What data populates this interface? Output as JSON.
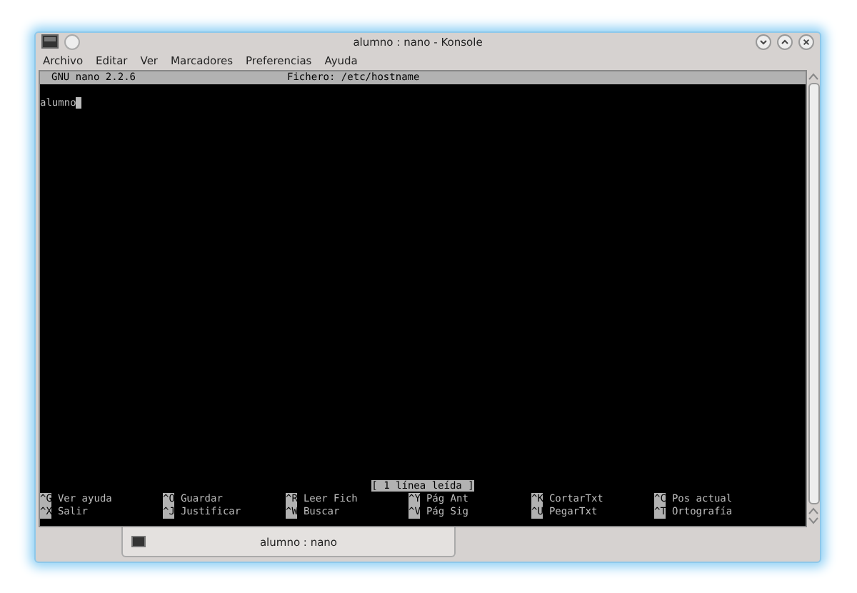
{
  "window": {
    "title": "alumno : nano - Konsole"
  },
  "menu": [
    "Archivo",
    "Editar",
    "Ver",
    "Marcadores",
    "Preferencias",
    "Ayuda"
  ],
  "nano": {
    "version": "GNU nano 2.2.6",
    "file": "Fichero: /etc/hostname",
    "lines": [
      "alumno"
    ],
    "status": "[ 1 línea leída ]",
    "shortcuts": [
      [
        {
          "key": "^G",
          "label": "Ver ayuda"
        },
        {
          "key": "^O",
          "label": "Guardar"
        },
        {
          "key": "^R",
          "label": "Leer Fich"
        },
        {
          "key": "^Y",
          "label": "Pág Ant"
        },
        {
          "key": "^K",
          "label": "CortarTxt"
        },
        {
          "key": "^C",
          "label": "Pos actual"
        }
      ],
      [
        {
          "key": "^X",
          "label": "Salir"
        },
        {
          "key": "^J",
          "label": "Justificar"
        },
        {
          "key": "^W",
          "label": "Buscar"
        },
        {
          "key": "^V",
          "label": "Pág Sig"
        },
        {
          "key": "^U",
          "label": "PegarTxt"
        },
        {
          "key": "^T",
          "label": "Ortografía"
        }
      ]
    ]
  },
  "tab": {
    "title": "alumno : nano"
  }
}
